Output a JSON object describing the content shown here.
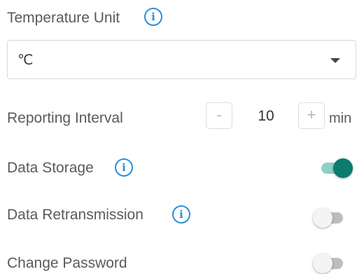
{
  "temperature_unit": {
    "label": "Temperature Unit",
    "info_icon": "info-icon",
    "selected": "℃",
    "caret_icon": "chevron-down-icon"
  },
  "reporting_interval": {
    "label": "Reporting Interval",
    "decrement_label": "-",
    "value": "10",
    "increment_label": "+",
    "unit": "min"
  },
  "data_storage": {
    "label": "Data Storage",
    "info_icon": "info-icon",
    "enabled": true
  },
  "data_retransmission": {
    "label": "Data Retransmission",
    "info_icon": "info-icon",
    "enabled": false
  },
  "change_password": {
    "label": "Change Password",
    "enabled": false
  },
  "colors": {
    "accent": "#0b7c6e",
    "info": "#2b8fd6"
  }
}
